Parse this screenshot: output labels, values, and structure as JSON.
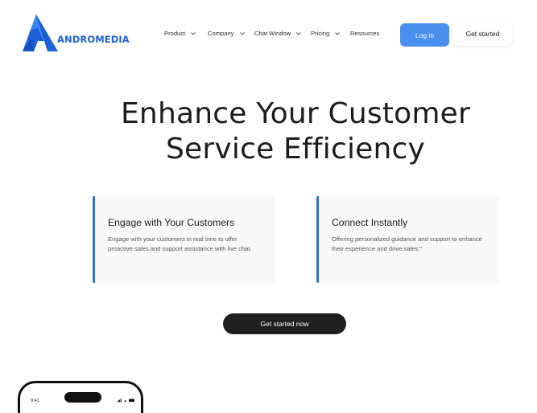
{
  "brand": {
    "name": "ANDROMEDIA",
    "color": "#1d5fd6",
    "logo_icon": "triangle-a-logo"
  },
  "nav": {
    "items": [
      {
        "label": "Product",
        "has_dropdown": true
      },
      {
        "label": "Company",
        "has_dropdown": true
      },
      {
        "label": "Chat Window",
        "has_dropdown": true
      },
      {
        "label": "Pricing",
        "has_dropdown": true
      },
      {
        "label": "Resources",
        "has_dropdown": false
      }
    ],
    "login_label": "Log in",
    "get_started_label": "Get started",
    "login_color": "#4a8ff0"
  },
  "hero": {
    "title_line1": "Enhance Your Customer",
    "title_line2": "Service Efficiency"
  },
  "features": [
    {
      "title": "Engage with Your Customers",
      "text": "Engage with your customers in real time to offer proactive sales and support assistance with live chat."
    },
    {
      "title": "Connect Instantly",
      "text": "Offering personalized guidance and support to enhance their experience and drive sales.\""
    }
  ],
  "feature_accent": "#2f6fd9",
  "cta": {
    "label": "Get started now",
    "color": "#1f1f1f"
  },
  "phone": {
    "time": "9:41"
  }
}
